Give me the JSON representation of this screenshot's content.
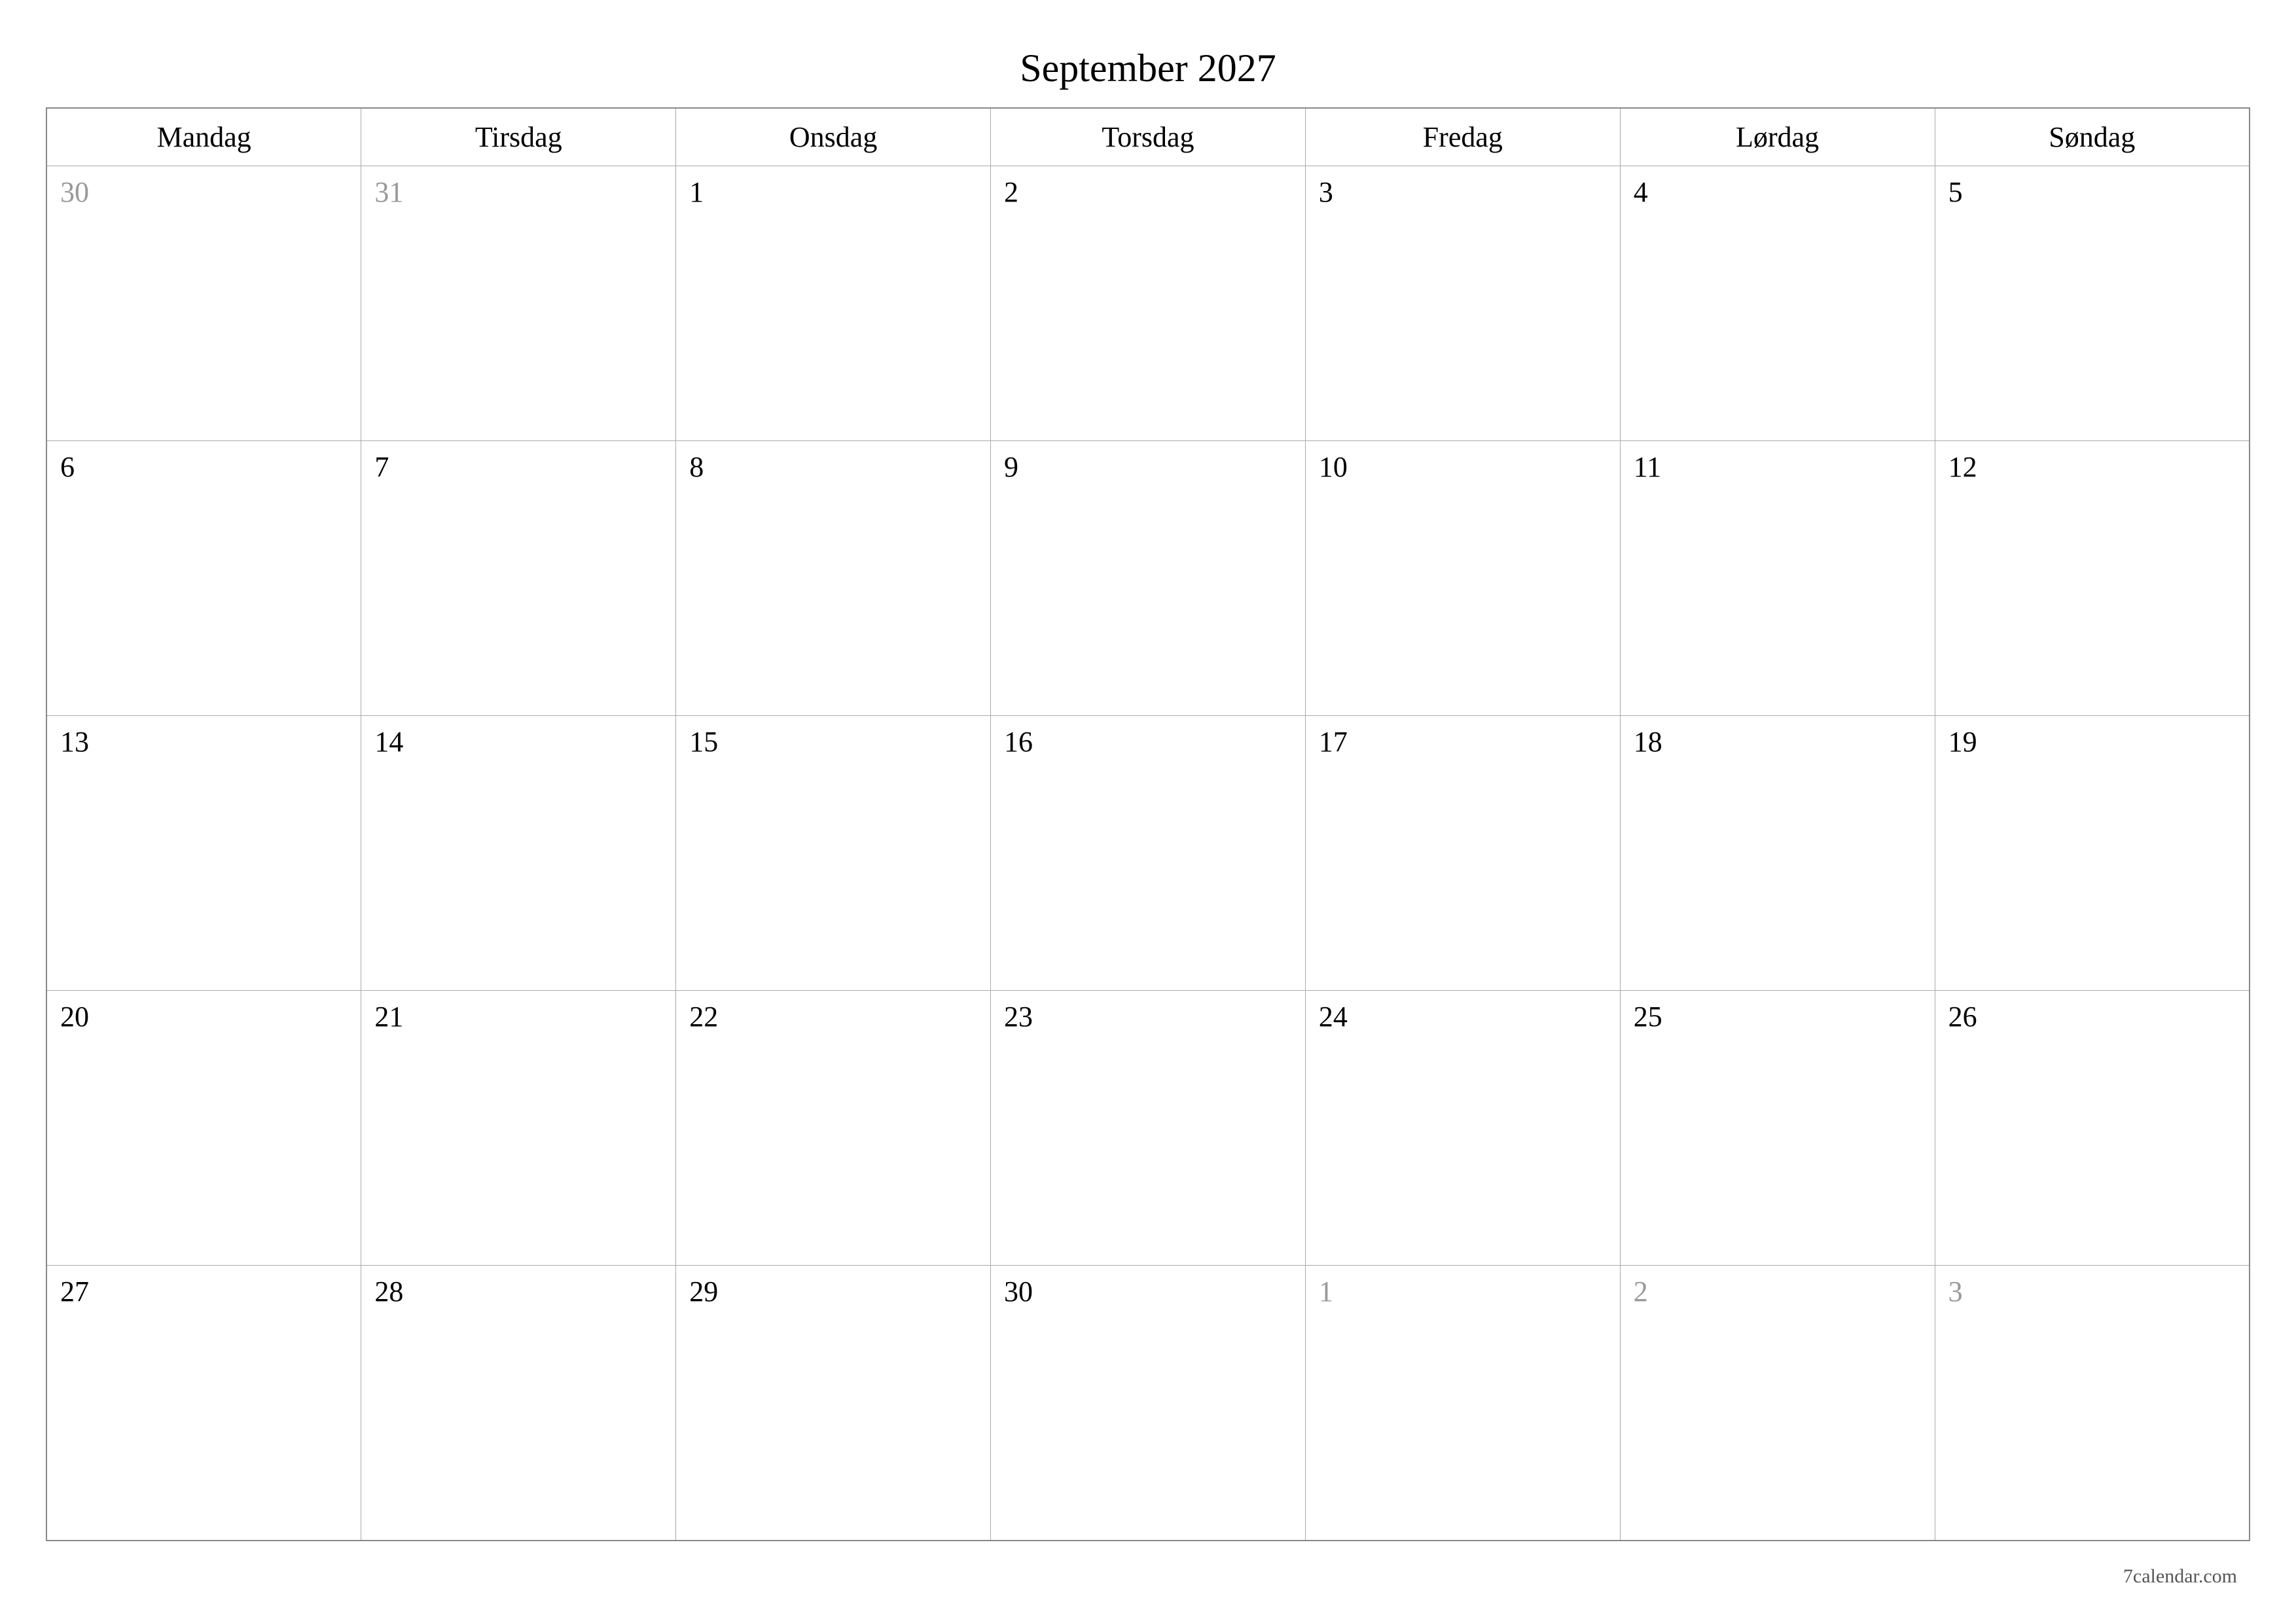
{
  "title": "September 2027",
  "weekdays": [
    "Mandag",
    "Tirsdag",
    "Onsdag",
    "Torsdag",
    "Fredag",
    "Lørdag",
    "Søndag"
  ],
  "weeks": [
    [
      {
        "day": "30",
        "other": true
      },
      {
        "day": "31",
        "other": true
      },
      {
        "day": "1",
        "other": false
      },
      {
        "day": "2",
        "other": false
      },
      {
        "day": "3",
        "other": false
      },
      {
        "day": "4",
        "other": false
      },
      {
        "day": "5",
        "other": false
      }
    ],
    [
      {
        "day": "6",
        "other": false
      },
      {
        "day": "7",
        "other": false
      },
      {
        "day": "8",
        "other": false
      },
      {
        "day": "9",
        "other": false
      },
      {
        "day": "10",
        "other": false
      },
      {
        "day": "11",
        "other": false
      },
      {
        "day": "12",
        "other": false
      }
    ],
    [
      {
        "day": "13",
        "other": false
      },
      {
        "day": "14",
        "other": false
      },
      {
        "day": "15",
        "other": false
      },
      {
        "day": "16",
        "other": false
      },
      {
        "day": "17",
        "other": false
      },
      {
        "day": "18",
        "other": false
      },
      {
        "day": "19",
        "other": false
      }
    ],
    [
      {
        "day": "20",
        "other": false
      },
      {
        "day": "21",
        "other": false
      },
      {
        "day": "22",
        "other": false
      },
      {
        "day": "23",
        "other": false
      },
      {
        "day": "24",
        "other": false
      },
      {
        "day": "25",
        "other": false
      },
      {
        "day": "26",
        "other": false
      }
    ],
    [
      {
        "day": "27",
        "other": false
      },
      {
        "day": "28",
        "other": false
      },
      {
        "day": "29",
        "other": false
      },
      {
        "day": "30",
        "other": false
      },
      {
        "day": "1",
        "other": true
      },
      {
        "day": "2",
        "other": true
      },
      {
        "day": "3",
        "other": true
      }
    ]
  ],
  "footer": "7calendar.com"
}
